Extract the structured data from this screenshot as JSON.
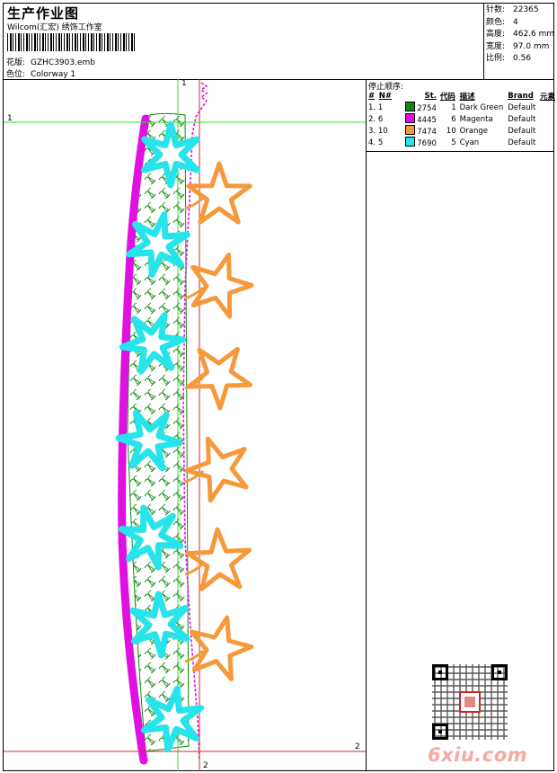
{
  "header": {
    "title": "生产作业图",
    "subtitle": "Wilcom(汇宏) 绣饰工作室",
    "design_label": "花版:",
    "design_value": "GZHC3903.emb",
    "colorway_label": "色位:",
    "colorway_value": "Colorway 1"
  },
  "stats": {
    "stitches_label": "针数:",
    "stitches_value": "22365",
    "colors_label": "颜色:",
    "colors_value": "4",
    "height_label": "高度:",
    "height_value": "462.6 mm",
    "width_label": "宽度:",
    "width_value": "97.0 mm",
    "scale_label": "比例:",
    "scale_value": "0.56"
  },
  "stop_sequence": {
    "title": "停止顺序:",
    "headers": [
      "#",
      "N#",
      "St.",
      "代码",
      "描述",
      "Brand",
      "元素"
    ],
    "rows": [
      {
        "num": "1.",
        "needle": "1",
        "stitches": "2754",
        "code": "1",
        "desc": "Dark Green",
        "brand": "Default",
        "color": "#118a11"
      },
      {
        "num": "2.",
        "needle": "6",
        "stitches": "4445",
        "code": "6",
        "desc": "Magenta",
        "brand": "Default",
        "color": "#e010e0"
      },
      {
        "num": "3.",
        "needle": "10",
        "stitches": "7474",
        "code": "10",
        "desc": "Orange",
        "brand": "Default",
        "color": "#f5993a"
      },
      {
        "num": "4.",
        "needle": "5",
        "stitches": "7690",
        "code": "5",
        "desc": "Cyan",
        "brand": "Default",
        "color": "#26e4ea"
      }
    ]
  },
  "guides": {
    "v1_label": "1",
    "v2_label": "2",
    "h1_label": "1",
    "h2_label": "2",
    "line_green": "#33dd33",
    "line_red": "#dd2222"
  },
  "watermark": "6xiu.com",
  "colors": {
    "green": "#118a11",
    "magenta": "#e010e0",
    "orange": "#f5993a",
    "cyan": "#26e4ea"
  }
}
